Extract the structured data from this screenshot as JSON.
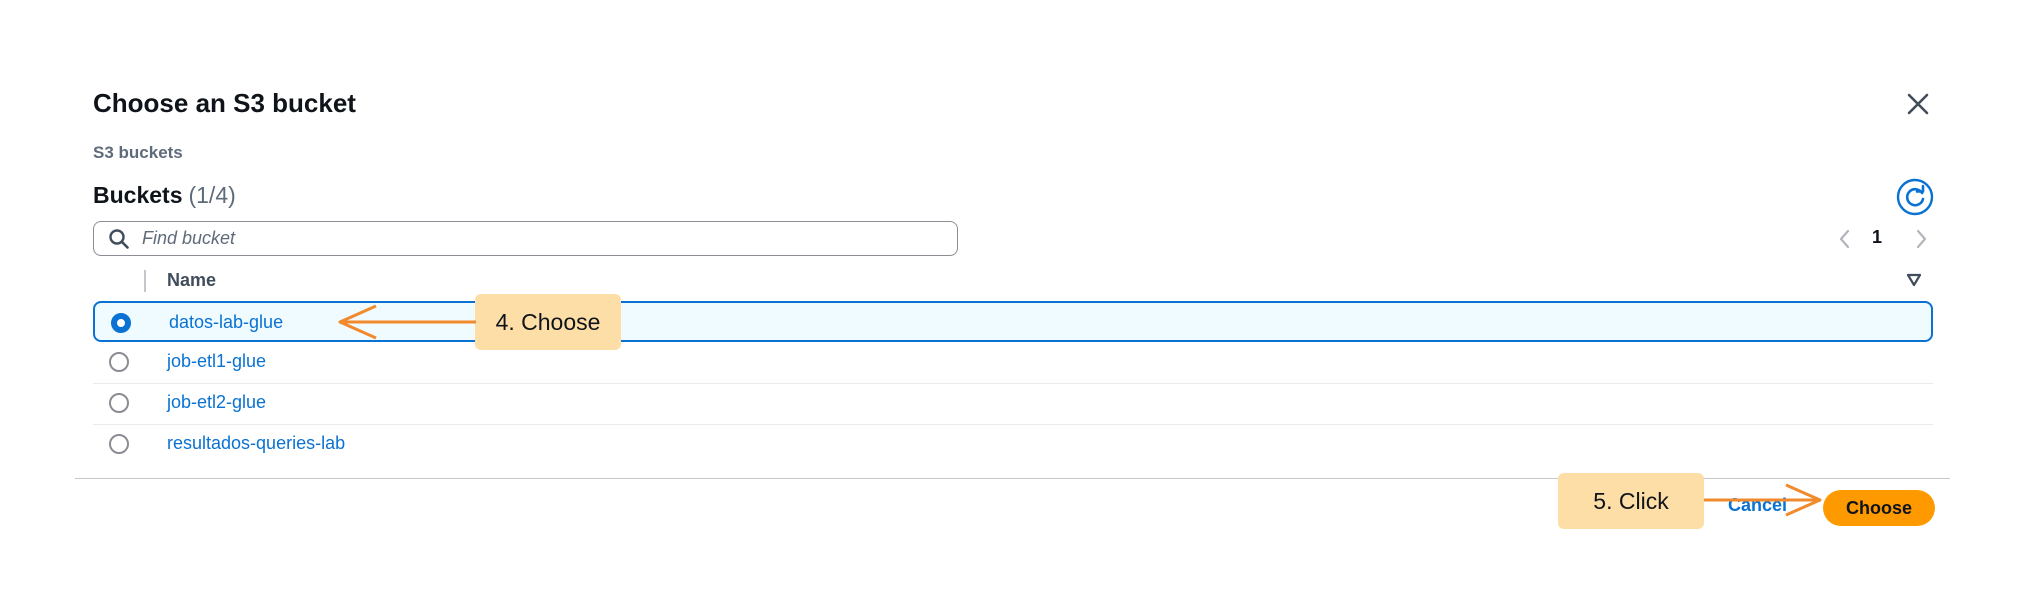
{
  "modal": {
    "title": "Choose an S3 bucket",
    "subtitle": "S3 buckets"
  },
  "buckets": {
    "heading": "Buckets",
    "count": "(1/4)",
    "search_placeholder": "Find bucket",
    "page_number": "1",
    "column_name": "Name",
    "rows": [
      {
        "name": "datos-lab-glue",
        "selected": true
      },
      {
        "name": "job-etl1-glue",
        "selected": false
      },
      {
        "name": "job-etl2-glue",
        "selected": false
      },
      {
        "name": "resultados-queries-lab",
        "selected": false
      }
    ]
  },
  "footer": {
    "cancel_label": "Cancel",
    "choose_label": "Choose"
  },
  "annotations": {
    "step4": "4. Choose",
    "step5": "5. Click"
  },
  "colors": {
    "accent": "#0972d3",
    "primary_button": "#ff9900",
    "callout": "#fddea6",
    "arrow": "#f08a2c"
  },
  "icons": [
    "close-icon",
    "refresh-icon",
    "search-icon",
    "chevron-left-icon",
    "chevron-right-icon",
    "sort-down-icon"
  ]
}
